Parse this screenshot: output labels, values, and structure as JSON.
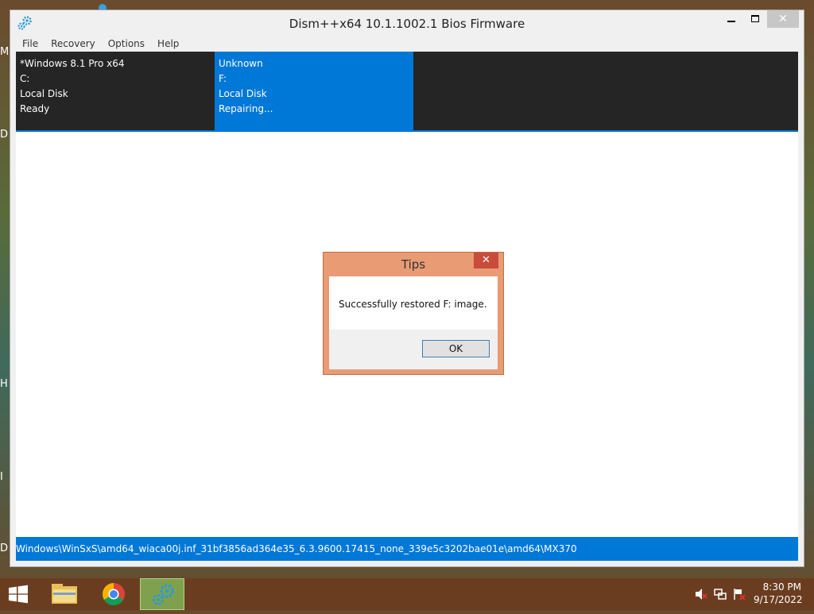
{
  "window": {
    "title": "Dism++x64 10.1.1002.1 Bios Firmware",
    "close_symbol": "✕"
  },
  "menu": [
    "File",
    "Recovery",
    "Options",
    "Help"
  ],
  "images": [
    {
      "name": "*Windows 8.1 Pro x64",
      "drive": "C:",
      "type": "Local Disk",
      "status": "Ready"
    },
    {
      "name": "Unknown",
      "drive": "F:",
      "type": "Local Disk",
      "status": "Repairing..."
    }
  ],
  "status_path": "Windows\\WinSxS\\amd64_wiaca00j.inf_31bf3856ad364e35_6.3.9600.17415_none_339e5c3202bae01e\\amd64\\MX370",
  "dialog": {
    "title": "Tips",
    "close_symbol": "✕",
    "message": "Successfully restored F: image.",
    "ok_label": "OK"
  },
  "desktop_edge_letters": [
    "M",
    "D",
    "H",
    "I",
    "D"
  ],
  "taskbar": {
    "items": [
      "file-explorer-icon",
      "chrome-icon",
      "dism-icon"
    ],
    "tray": [
      "volume-muted-icon",
      "network-icon",
      "action-center-icon"
    ],
    "time": "8:30 PM",
    "date": "9/17/2022"
  },
  "colors": {
    "accent": "#0078d7",
    "dialog_frame": "#e99b74",
    "taskbar": "#6b3d20"
  }
}
